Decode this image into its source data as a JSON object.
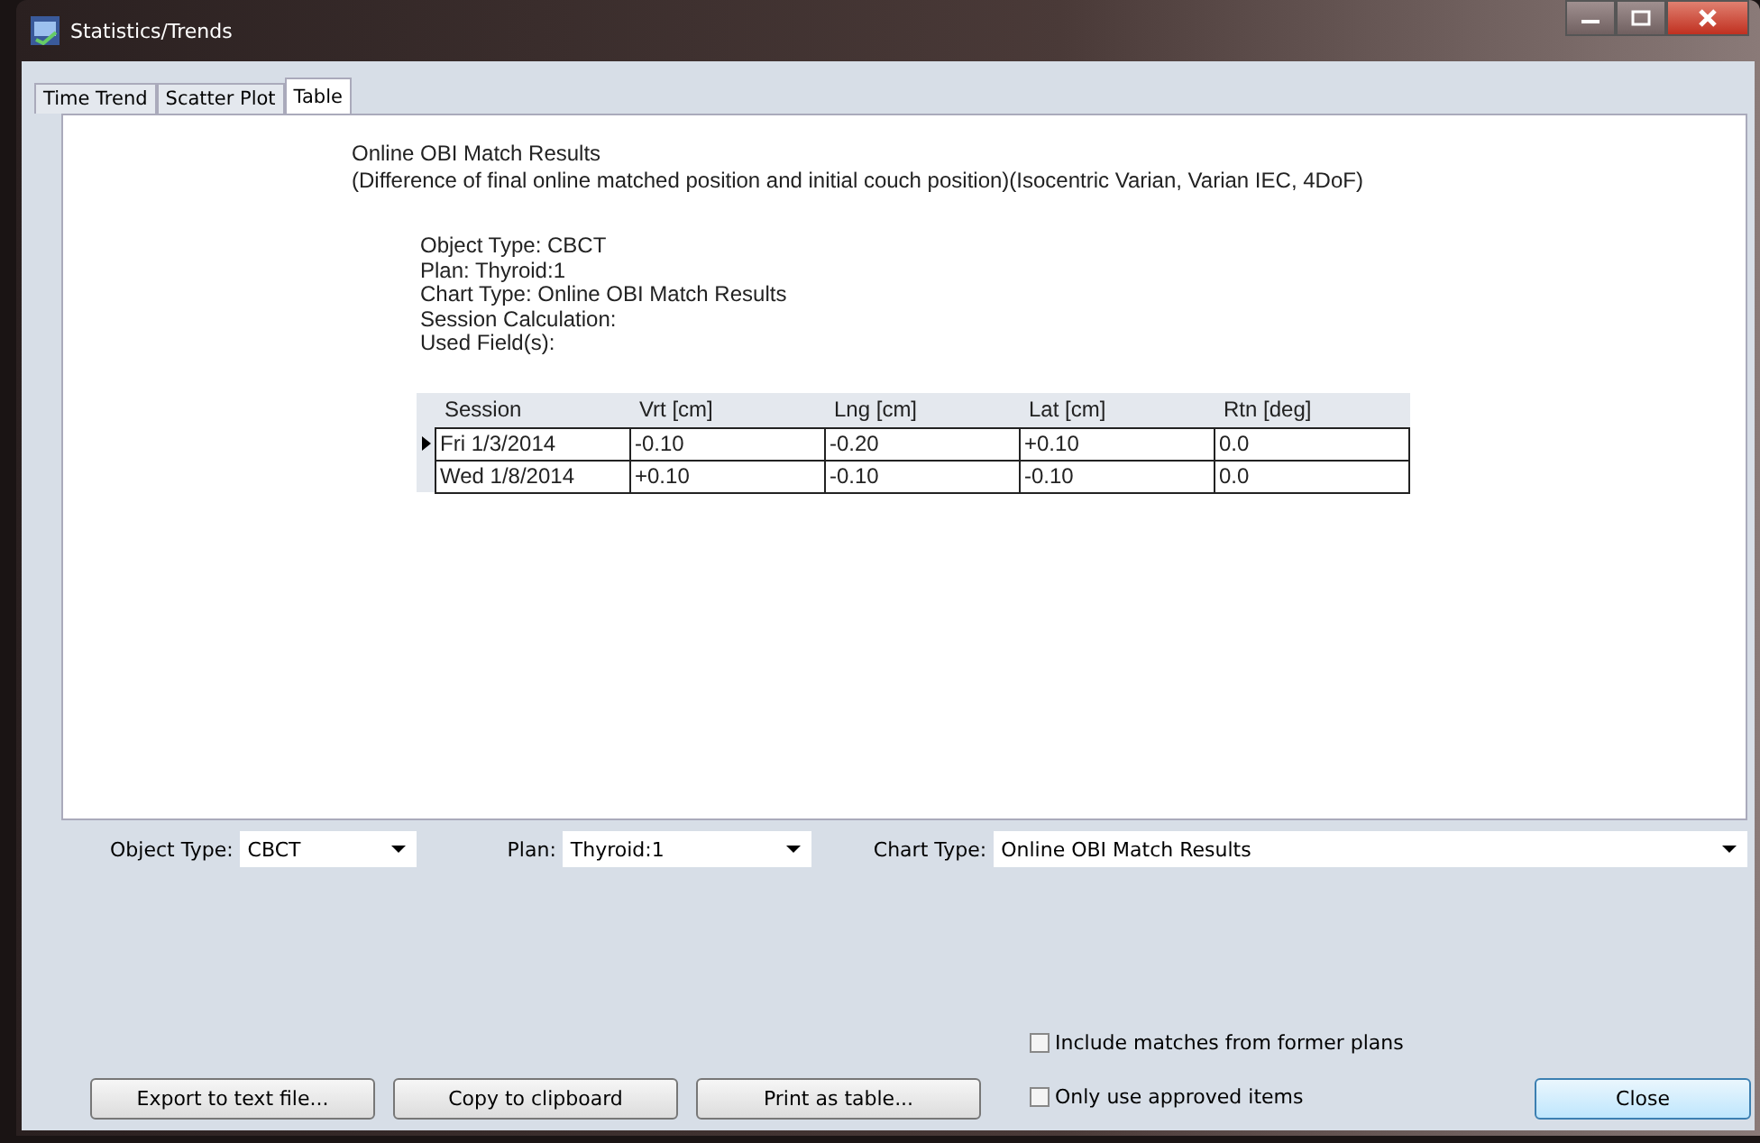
{
  "window": {
    "title": "Statistics/Trends"
  },
  "tabs": [
    {
      "label": "Time Trend",
      "selected": false
    },
    {
      "label": "Scatter Plot",
      "selected": false
    },
    {
      "label": "Table",
      "selected": true
    }
  ],
  "report": {
    "title": "Online OBI Match Results",
    "subtitle": "(Difference of final online matched position and initial couch position)(Isocentric Varian, Varian IEC, 4DoF)",
    "details": [
      "Object Type: CBCT",
      "Plan: Thyroid:1",
      "Chart Type: Online OBI Match Results",
      "Session Calculation:",
      "Used Field(s):"
    ]
  },
  "table": {
    "columns": [
      "Session",
      "Vrt [cm]",
      "Lng [cm]",
      "Lat [cm]",
      "Rtn [deg]"
    ],
    "rows": [
      {
        "selected": true,
        "cells": [
          "Fri 1/3/2014",
          "-0.10",
          "-0.20",
          "+0.10",
          "0.0"
        ]
      },
      {
        "selected": false,
        "cells": [
          "Wed 1/8/2014",
          "+0.10",
          "-0.10",
          "-0.10",
          "0.0"
        ]
      }
    ]
  },
  "filters": [
    {
      "label": "Object Type:",
      "value": "CBCT"
    },
    {
      "label": "Plan:",
      "value": "Thyroid:1"
    },
    {
      "label": "Chart Type:",
      "value": "Online OBI Match Results"
    }
  ],
  "options": [
    {
      "label": "Include matches from former plans",
      "checked": false
    },
    {
      "label": "Only use approved items",
      "checked": false
    }
  ],
  "buttons": [
    "Export to text file...",
    "Copy to clipboard",
    "Print as table..."
  ],
  "close_button": "Close"
}
